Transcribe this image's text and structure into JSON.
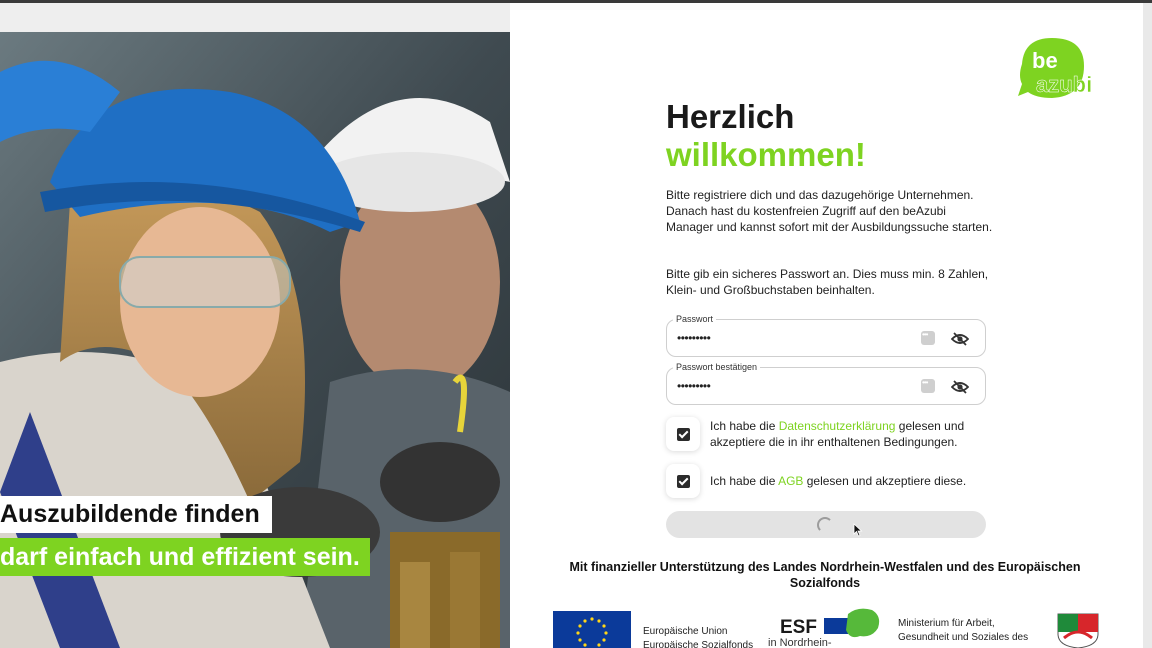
{
  "hero": {
    "tag_line1": "Auszubildende finden",
    "tag_line2": "darf einfach und effizient sein."
  },
  "brand": {
    "logo_line1": "be",
    "logo_line2": "azubi",
    "accent_color": "#7ed321"
  },
  "welcome": {
    "line1": "Herzlich",
    "line2": "willkommen!"
  },
  "intro_text": "Bitte registriere dich und das dazugehörige Unternehmen. Danach hast du kostenfreien Zugriff auf den beAzubi Manager und kannst sofort mit der Ausbildungssuche starten.",
  "password_hint": "Bitte gib ein sicheres Passwort an. Dies muss min. 8 Zahlen, Klein- und Großbuchstaben beinhalten.",
  "fields": {
    "password": {
      "label": "Passwort",
      "value": "•••••••••",
      "toggle_icon": "eye-off-icon",
      "manager_icon": "password-manager-icon"
    },
    "confirm": {
      "label": "Passwort bestätigen",
      "value": "•••••••••",
      "toggle_icon": "eye-off-icon",
      "manager_icon": "password-manager-icon"
    }
  },
  "consents": {
    "privacy": {
      "checked": true,
      "before": "Ich habe die ",
      "link": "Datenschutzerklärung",
      "after": " gelesen und akzeptiere die in ihr enthaltenen Bedingungen."
    },
    "terms": {
      "checked": true,
      "before": "Ich habe die ",
      "link": "AGB",
      "after": " gelesen und akzeptiere diese."
    }
  },
  "submit": {
    "state": "loading",
    "icon": "spinner-icon"
  },
  "funding": {
    "text": "Mit finanzieller Unterstützung des Landes Nordrhein-Westfalen und des Europäischen Sozialfonds",
    "eu_line1": "Europäische Union",
    "eu_line2": "Europäische Sozialfonds",
    "esf_label": "ESF",
    "esf_sub": "in Nordrhein-",
    "ministry_line1": "Ministerium für Arbeit,",
    "ministry_line2": "Gesundheit und Soziales des"
  }
}
